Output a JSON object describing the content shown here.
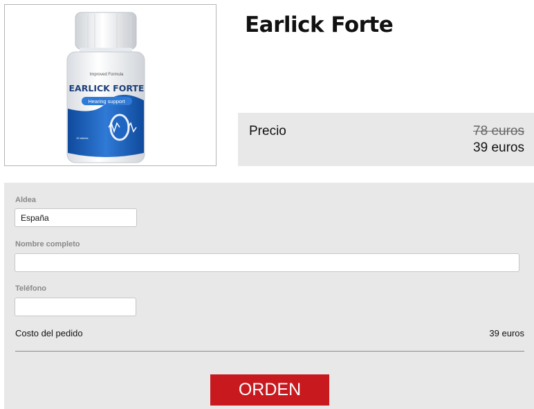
{
  "product": {
    "title": "Earlick Forte",
    "bottle": {
      "label_top": "Improved Formula",
      "label_brand": "EARLICK FORTE",
      "label_badge": "Hearing support",
      "label_count": "20 tablets"
    }
  },
  "price": {
    "label": "Precio",
    "old": "78 euros",
    "new": "39 euros"
  },
  "form": {
    "country_label": "Aldea",
    "country_value": "España",
    "name_label": "Nombre completo",
    "name_value": "",
    "phone_label": "Teléfono",
    "phone_value": "",
    "order_cost_label": "Costo del pedido",
    "order_cost_value": "39 euros",
    "submit_label": "ORDEN"
  },
  "colors": {
    "accent": "#c8191f",
    "panel": "#e8e8e8",
    "bottle_blue": "#1e5fb4"
  }
}
